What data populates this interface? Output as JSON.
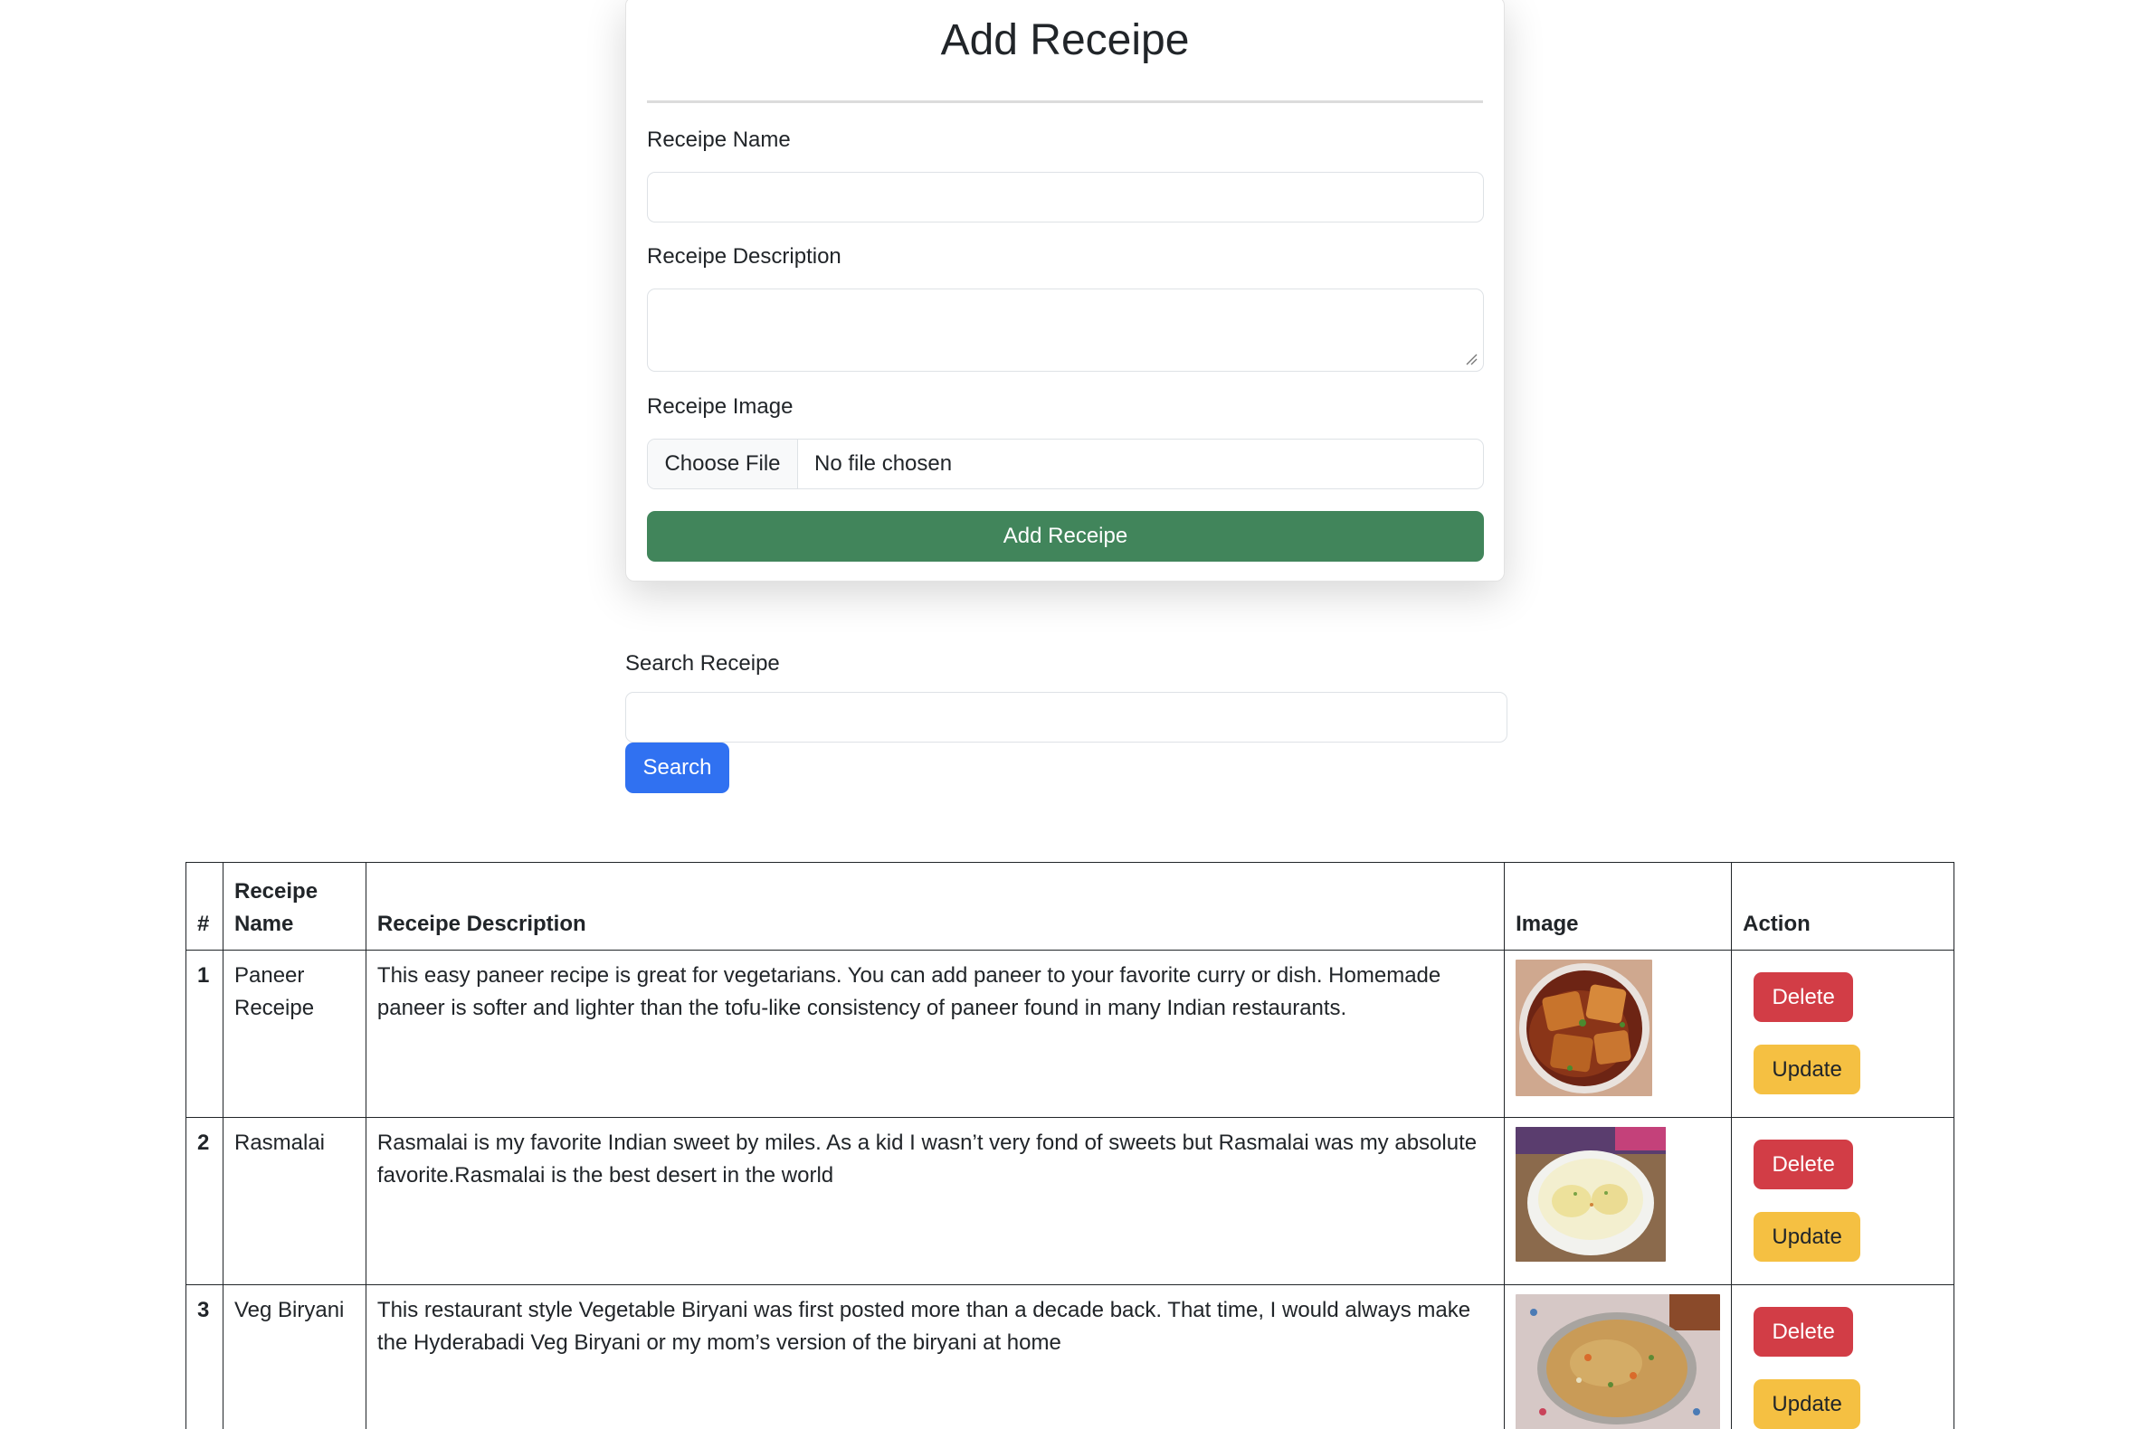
{
  "form": {
    "title": "Add Receipe",
    "name_label": "Receipe Name",
    "name_value": "",
    "description_label": "Receipe Description",
    "description_value": "",
    "image_label": "Receipe Image",
    "file_button": "Choose File",
    "file_status": "No file chosen",
    "submit_label": "Add Receipe"
  },
  "search": {
    "label": "Search Receipe",
    "value": "",
    "button_label": "Search"
  },
  "table": {
    "headers": {
      "index": "#",
      "name": "Receipe Name",
      "description": "Receipe Description",
      "image": "Image",
      "action": "Action"
    },
    "rows": [
      {
        "index": "1",
        "name": "Paneer Receipe",
        "description": "This easy paneer recipe is great for vegetarians. You can add paneer to your favorite curry or dish. Homemade paneer is softer and lighter than the tofu-like consistency of paneer found in many Indian restaurants.",
        "image_icon": "paneer-dish-photo",
        "delete_label": "Delete",
        "update_label": "Update"
      },
      {
        "index": "2",
        "name": "Rasmalai",
        "description": "Rasmalai is my favorite Indian sweet by miles. As a kid I wasn’t very fond of sweets but Rasmalai was my absolute favorite.Rasmalai is the best desert in the world",
        "image_icon": "rasmalai-bowl-photo",
        "delete_label": "Delete",
        "update_label": "Update"
      },
      {
        "index": "3",
        "name": "Veg Biryani",
        "description": "This restaurant style Vegetable Biryani was first posted more than a decade back. That time, I would always make the Hyderabadi Veg Biryani or my mom’s version of the biryani at home",
        "image_icon": "biryani-bowl-photo",
        "delete_label": "Delete",
        "update_label": "Update"
      }
    ]
  },
  "colors": {
    "success": "#41855b",
    "primary": "#3071f1",
    "danger": "#d23d46",
    "warning": "#f5c042"
  }
}
